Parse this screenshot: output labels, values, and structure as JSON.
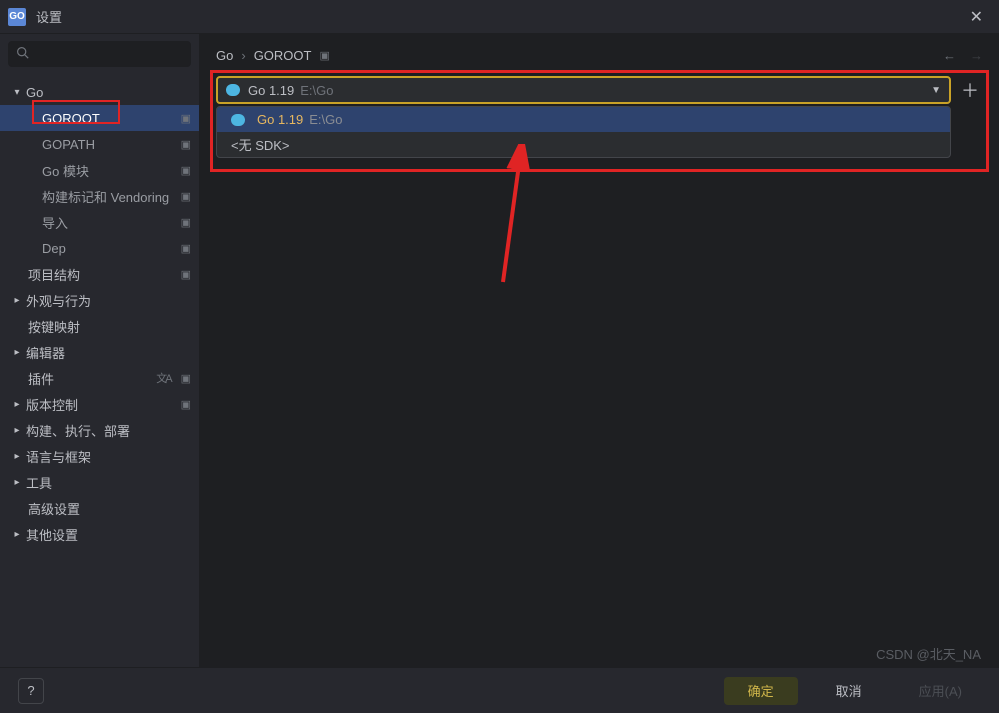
{
  "window": {
    "title": "设置",
    "app_badge": "GO"
  },
  "search": {
    "placeholder": ""
  },
  "tree": {
    "go": {
      "label": "Go",
      "children": {
        "goroot": {
          "label": "GOROOT"
        },
        "gopath": {
          "label": "GOPATH"
        },
        "modules": {
          "label": "Go 模块"
        },
        "vendor": {
          "label": "构建标记和 Vendoring"
        },
        "import": {
          "label": "导入"
        },
        "dep": {
          "label": "Dep"
        }
      }
    },
    "project_structure": {
      "label": "项目结构"
    },
    "appearance": {
      "label": "外观与行为"
    },
    "keymap": {
      "label": "按键映射"
    },
    "editor": {
      "label": "编辑器"
    },
    "plugins": {
      "label": "插件"
    },
    "vcs": {
      "label": "版本控制"
    },
    "build": {
      "label": "构建、执行、部署"
    },
    "lang": {
      "label": "语言与框架"
    },
    "tools": {
      "label": "工具"
    },
    "advanced": {
      "label": "高级设置"
    },
    "other": {
      "label": "其他设置"
    }
  },
  "breadcrumb": {
    "a": "Go",
    "b": "GOROOT"
  },
  "sdk": {
    "selected": {
      "name": "Go 1.19",
      "path": "E:\\Go"
    },
    "options": [
      {
        "name": "Go 1.19",
        "path": "E:\\Go"
      },
      {
        "none": "<无 SDK>"
      }
    ]
  },
  "footer": {
    "ok": "确定",
    "cancel": "取消",
    "apply": "应用(A)",
    "help": "?"
  },
  "watermark": "CSDN @北天_NA"
}
